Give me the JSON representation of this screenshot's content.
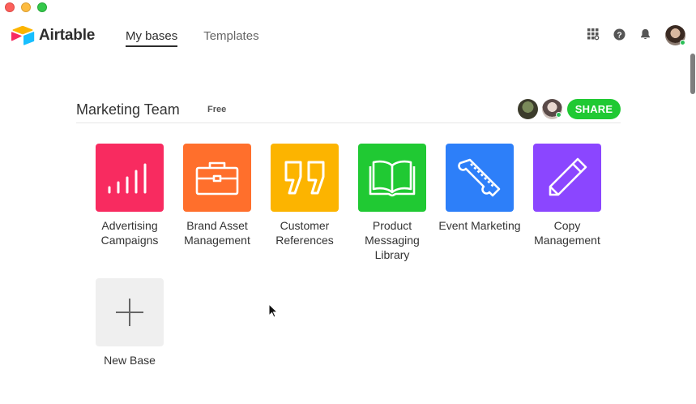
{
  "window": {
    "controls": [
      "close",
      "minimize",
      "maximize"
    ]
  },
  "header": {
    "logo_text": "Airtable",
    "logo_icon": "airtable-logo-icon",
    "tabs": [
      {
        "label": "My bases",
        "active": true
      },
      {
        "label": "Templates",
        "active": false
      }
    ],
    "icons": [
      "apps-grid-icon",
      "help-icon",
      "notifications-bell-icon"
    ],
    "account": "user-avatar"
  },
  "workspace": {
    "title": "Marketing Team",
    "plan": "Free",
    "share_label": "SHARE",
    "collaborators": [
      "collaborator-avatar-1",
      "collaborator-avatar-2"
    ]
  },
  "bases": [
    {
      "name": "Advertising Campaigns",
      "color": "#f82b60",
      "icon": "bar-chart-icon"
    },
    {
      "name": "Brand Asset Management",
      "color": "#ff6f2c",
      "icon": "briefcase-icon"
    },
    {
      "name": "Customer References",
      "color": "#fcb400",
      "icon": "quote-icon"
    },
    {
      "name": "Product Messaging Library",
      "color": "#20c933",
      "icon": "book-icon"
    },
    {
      "name": "Event Marketing",
      "color": "#2d7ff9",
      "icon": "ticket-icon"
    },
    {
      "name": "Copy Management",
      "color": "#8b46ff",
      "icon": "pencil-icon"
    }
  ],
  "new_base": {
    "label": "New Base",
    "icon": "plus-icon"
  },
  "colors": {
    "accent_green": "#20c933",
    "online": "#2bbf57"
  }
}
